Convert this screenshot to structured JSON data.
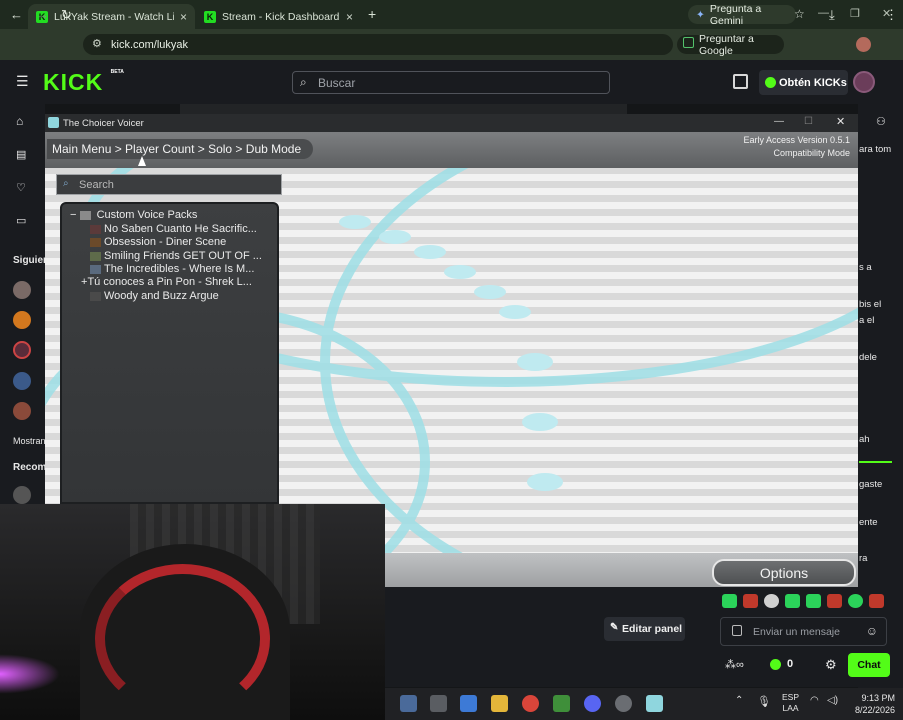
{
  "browser": {
    "tabs": [
      {
        "label": "LukYak Stream - Watch Live on",
        "close": "×"
      },
      {
        "label": "Stream - Kick Dashboard",
        "close": "×"
      }
    ],
    "new_tab": "+",
    "gemini_label": "Pregunta a Gemini",
    "url": "kick.com/lukyak",
    "translate_label": "Preguntar a Google"
  },
  "kick": {
    "logo": "KICK",
    "logo_badge": "BETA",
    "search_placeholder": "Buscar",
    "get_kicks_label": "Obtén KICKs",
    "sidebar_following": "Siguien",
    "sidebar_show_more": "Mostran",
    "sidebar_recommended": "Recom",
    "chat_fragments": [
      "ara tom",
      "s a",
      "bis el",
      "a el",
      "dele",
      "ah",
      "gaste",
      "ente",
      "ra"
    ],
    "edit_panel_label": "Editar panel",
    "chat_placeholder": "Enviar un mensaje",
    "kick_count": "0",
    "chat_button": "Chat"
  },
  "app": {
    "window_title": "The Choicer Voicer",
    "breadcrumb": "Main Menu > Player Count > Solo > Dub Mode",
    "version_line1": "Early Access Version 0.5.1",
    "version_line2": "Compatibility Mode",
    "search_placeholder": "Search",
    "tree_root": "Custom Voice Packs",
    "tree_items": [
      "No Saben Cuanto He Sacrific...",
      "Obsession - Diner Scene",
      "Smiling Friends GET OUT OF ...",
      "The Incredibles - Where Is M...",
      "Tú conoces a Pin Pon - Shrek L...",
      "Woody and Buzz Argue"
    ],
    "options_label": "Options"
  },
  "taskbar": {
    "lang_line1": "ESP",
    "lang_line2": "LAA",
    "time": "9:13 PM",
    "date": "8/22/2026"
  },
  "colors": {
    "kick_green": "#53fc18",
    "accent_cyan": "#9edfe6"
  }
}
